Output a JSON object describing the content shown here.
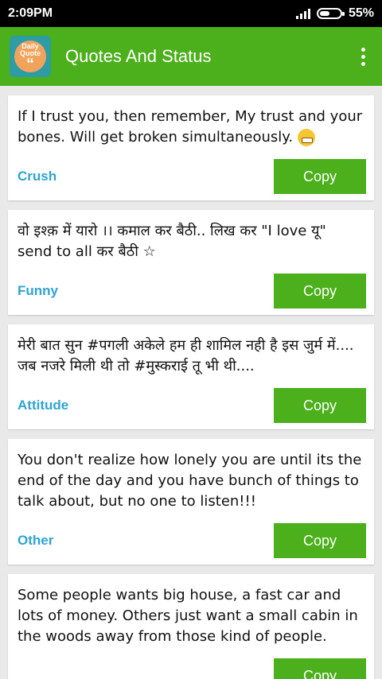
{
  "status": {
    "time": "2:09PM",
    "battery": "55%"
  },
  "app": {
    "title": "Quotes And Status",
    "logo_line1": "Daily",
    "logo_line2": "Quote",
    "logo_mark": "“"
  },
  "quotes": [
    {
      "text": "If I trust you, then remember, My trust and your bones. Will get broken simultaneously.",
      "emoji": "grimacing-face-icon",
      "category": "Crush",
      "copy_label": "Copy"
    },
    {
      "text": "वो इश्क़ में यारो ।। कमाल कर बैठी.. लिख कर \"I love यू\" send to all कर बैठी ☆",
      "category": "Funny",
      "copy_label": "Copy"
    },
    {
      "text": "मेरी बात सुन #पगली अकेले हम ही शामिल नही है इस जुर्म में.... जब नजरे मिली थी तो #मुस्कराई तू भी थी....",
      "category": "Attitude",
      "copy_label": "Copy"
    },
    {
      "text": "You don't realize how lonely you are until its the end of the day and you have bunch of things to talk about, but no one to listen!!!",
      "category": "Other",
      "copy_label": "Copy"
    },
    {
      "text": "Some people wants big house, a fast car and lots of money. Others just want a small cabin in the woods away from those kind of people.",
      "category": "",
      "copy_label": "Copy"
    }
  ],
  "colors": {
    "primary": "#4caf1c",
    "category": "#2ea3d4",
    "background": "#e9e9e9"
  }
}
